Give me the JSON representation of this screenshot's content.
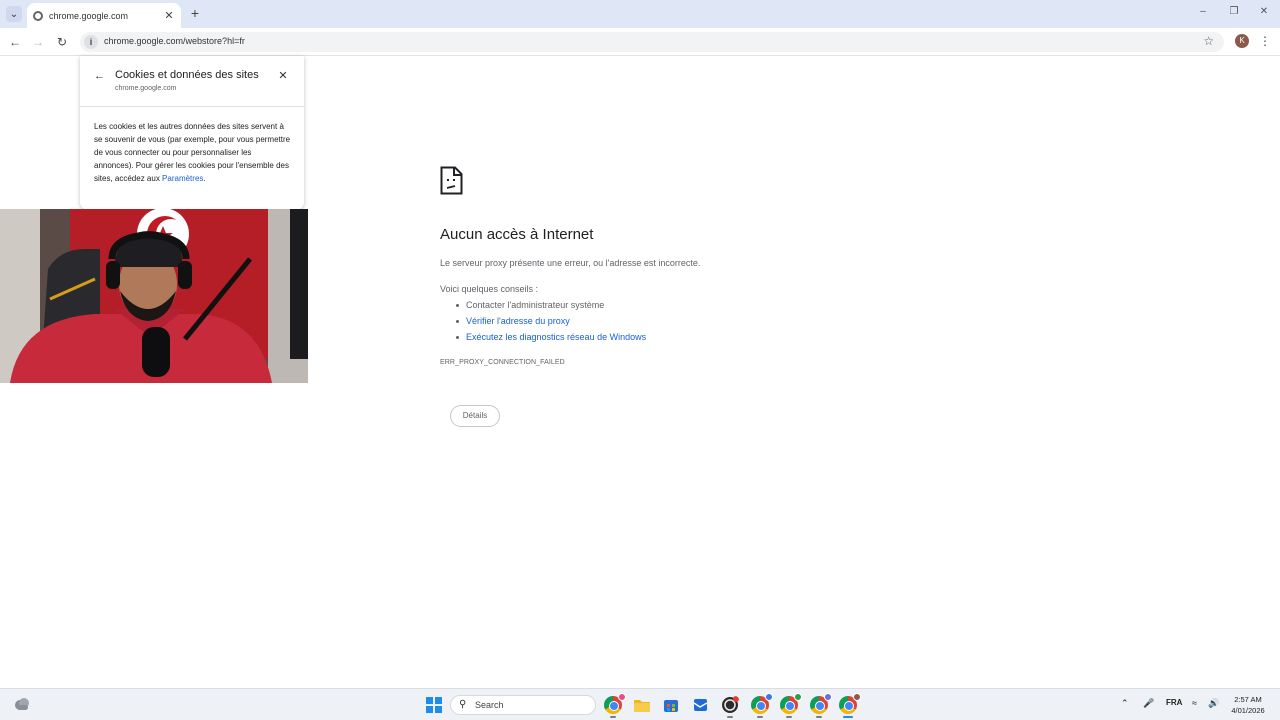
{
  "browser": {
    "tab": {
      "title": "chrome.google.com"
    },
    "new_tab_label": "+",
    "omnibox": {
      "url": "chrome.google.com/webstore?hl=fr"
    },
    "profile_initial": "K"
  },
  "cookies_popup": {
    "title": "Cookies et données des sites",
    "domain": "chrome.google.com",
    "description": "Les cookies et les autres données des sites servent à se souvenir de vous (par exemple, pour vous permettre de vous connecter ou pour personnaliser les annonces). Pour gérer les cookies pour l'ensemble des sites, accédez aux",
    "settings_link": "Paramètres",
    "period": "."
  },
  "error_page": {
    "title": "Aucun accès à Internet",
    "description": "Le serveur proxy présente une erreur, ou l'adresse est incorrecte.",
    "tips_label": "Voici quelques conseils :",
    "tips": [
      {
        "text": "Contacter l'administrateur système"
      },
      {
        "text": "Vérifier l'adresse du proxy"
      },
      {
        "text": "Exécutez les diagnostics réseau de Windows"
      }
    ],
    "error_code": "ERR_PROXY_CONNECTION_FAILED",
    "details_button": "Détails"
  },
  "taskbar": {
    "search_placeholder": "Search",
    "language": "FRA",
    "time": "2:57 AM",
    "date": "4/01/2026"
  },
  "colors": {
    "link": "#1a5fd0",
    "windows_accent": "#1f8bea",
    "tabstrip": "#dfe6f5"
  }
}
